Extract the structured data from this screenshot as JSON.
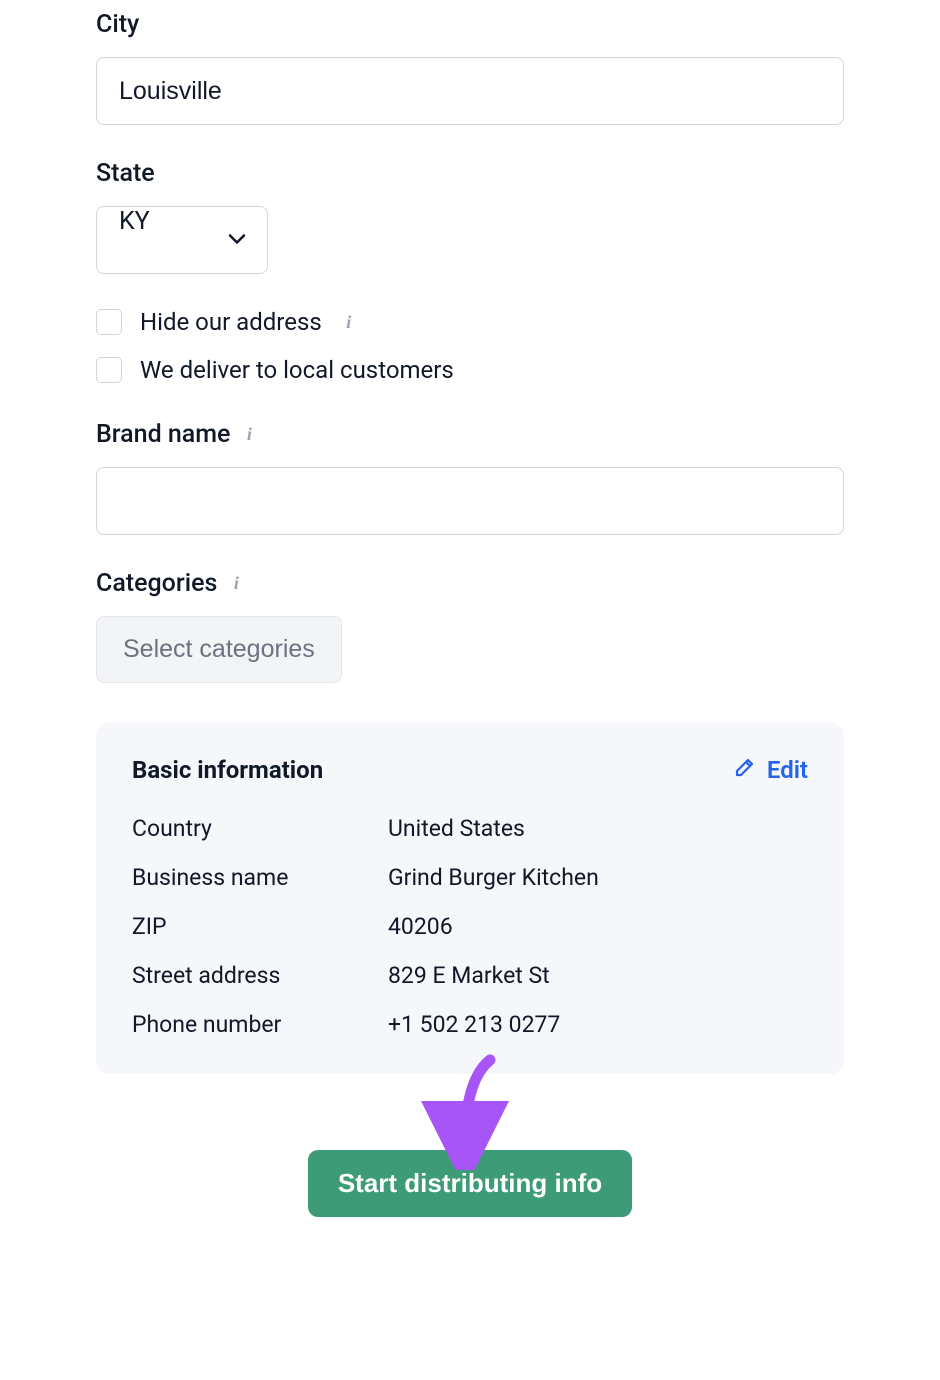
{
  "form": {
    "city": {
      "label": "City",
      "value": "Louisville"
    },
    "state": {
      "label": "State",
      "value": "KY"
    },
    "hide_address": {
      "label": "Hide our address",
      "checked": false
    },
    "deliver_local": {
      "label": "We deliver to local customers",
      "checked": false
    },
    "brand_name": {
      "label": "Brand name",
      "value": ""
    },
    "categories": {
      "label": "Categories",
      "button_label": "Select categories"
    }
  },
  "info_card": {
    "title": "Basic information",
    "edit_label": "Edit",
    "rows": {
      "country": {
        "key": "Country",
        "val": "United States"
      },
      "business_name": {
        "key": "Business name",
        "val": "Grind Burger Kitchen"
      },
      "zip": {
        "key": "ZIP",
        "val": "40206"
      },
      "street_address": {
        "key": "Street address",
        "val": "829 E Market St"
      },
      "phone": {
        "key": "Phone number",
        "val": "+1 502 213 0277"
      }
    }
  },
  "cta": {
    "label": "Start distributing info"
  }
}
